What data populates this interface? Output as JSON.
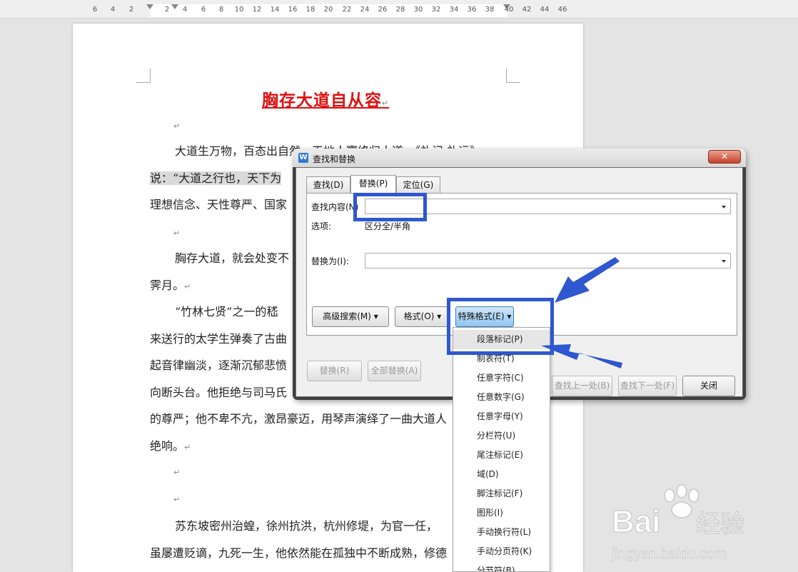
{
  "ruler": {
    "ticks": [
      "6",
      "4",
      "2",
      "2",
      "4",
      "6",
      "8",
      "10",
      "12",
      "14",
      "16",
      "18",
      "20",
      "22",
      "24",
      "26",
      "28",
      "30",
      "32",
      "34",
      "36",
      "38",
      "40",
      "42",
      "44",
      "46"
    ]
  },
  "document": {
    "title": "胸存大道自从容",
    "lines": [
      {
        "before": "大道生万物，百态出自然，天地人寰终归大道。《礼记 礼运》",
        "hl": ""
      },
      {
        "before": "说：“大道之行也，天下为",
        "hl": ""
      },
      {
        "before": "理想信念、天性尊严、国家",
        "hl": ""
      },
      {
        "before": "胸存大道，就会处变不",
        "hl": ""
      },
      {
        "before": "霁月。",
        "hl": ""
      },
      {
        "before": "“竹林七贤”之一的嵇",
        "hl": ""
      },
      {
        "before": "来送行的太学生弹奏了古曲",
        "hl": ""
      },
      {
        "before": "起音律幽淡，逐渐沉郁悲愤",
        "hl": ""
      },
      {
        "before": "向断头台。他拒绝与司马氏",
        "hl": ""
      },
      {
        "before": "的尊严；他不卑不亢，激昂豪迈，用琴声演绎了一曲大道人",
        "hl": ""
      },
      {
        "before": "绝响。",
        "hl": ""
      },
      {
        "before": "苏东坡密州治蝗，徐州抗洪，杭州修堤，为官一任，",
        "hl": ""
      },
      {
        "before": "虽屡遭贬谪，九死一生，他依然能在孤独中不断成熟，修德",
        "hl": ""
      }
    ]
  },
  "dialog": {
    "title": "查找和替换",
    "close_symbol": "✕",
    "tabs": [
      "查找(D)",
      "替换(P)",
      "定位(G)"
    ],
    "find_label": "查找内容(N)",
    "options_label": "选项:",
    "options_value": "区分全/半角",
    "replace_label": "替换为(I):",
    "advanced_search": "高级搜索(M)",
    "format": "格式(O)",
    "special_format": "特殊格式(E)",
    "replace_btn": "替换(R)",
    "replace_all_btn": "全部替换(A)",
    "find_prev_btn": "查找上一处(B)",
    "find_next_btn": "查找下一处(F)",
    "close_btn": "关闭"
  },
  "menu": {
    "items": [
      "段落标记(P)",
      "制表符(T)",
      "任意字符(C)",
      "任意数字(G)",
      "任意字母(Y)",
      "分栏符(U)",
      "尾注标记(E)",
      "域(D)",
      "脚注标记(F)",
      "图形(I)",
      "手动换行符(L)",
      "手动分页符(K)",
      "分节符(B)"
    ]
  },
  "watermark": {
    "brand": "Bai",
    "brand2": "经验",
    "url": "jingyan.baidu.com"
  },
  "colors": {
    "title_red": "#e20f0f",
    "annotation_blue": "#2e57d0",
    "dialog_frame": "#3f3f3f"
  }
}
